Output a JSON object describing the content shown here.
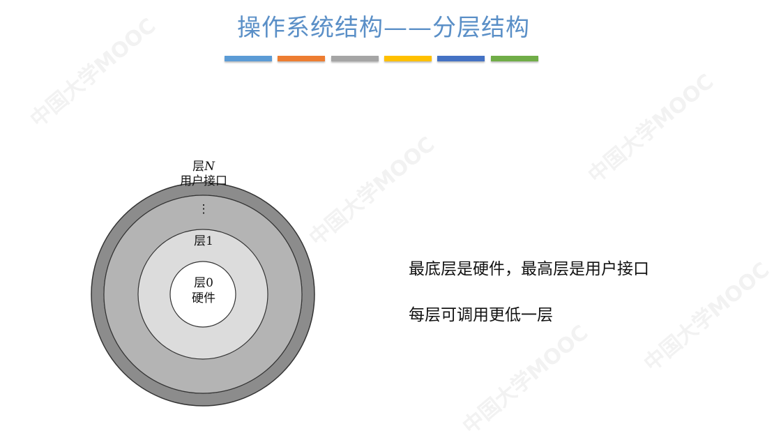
{
  "slide": {
    "title": "操作系统结构——分层结构",
    "accent_bars": [
      "#5b9bd5",
      "#ed7d31",
      "#a5a5a5",
      "#ffc000",
      "#4472c4",
      "#70ad47"
    ],
    "diagram": {
      "layer_n": {
        "name": "层",
        "index": "N",
        "desc": "用户接口"
      },
      "ellipsis": "⋮",
      "layer_1": "层1",
      "layer_0": {
        "name": "层0",
        "desc": "硬件"
      },
      "fills": {
        "outer": "#8c8c8c",
        "middle": "#b4b4b4",
        "inner": "#dcdcdc",
        "core": "#ffffff"
      }
    },
    "bullets": [
      "最底层是硬件，最高层是用户接口",
      "每层可调用更低一层"
    ],
    "watermark": "中国大学MOOC"
  }
}
